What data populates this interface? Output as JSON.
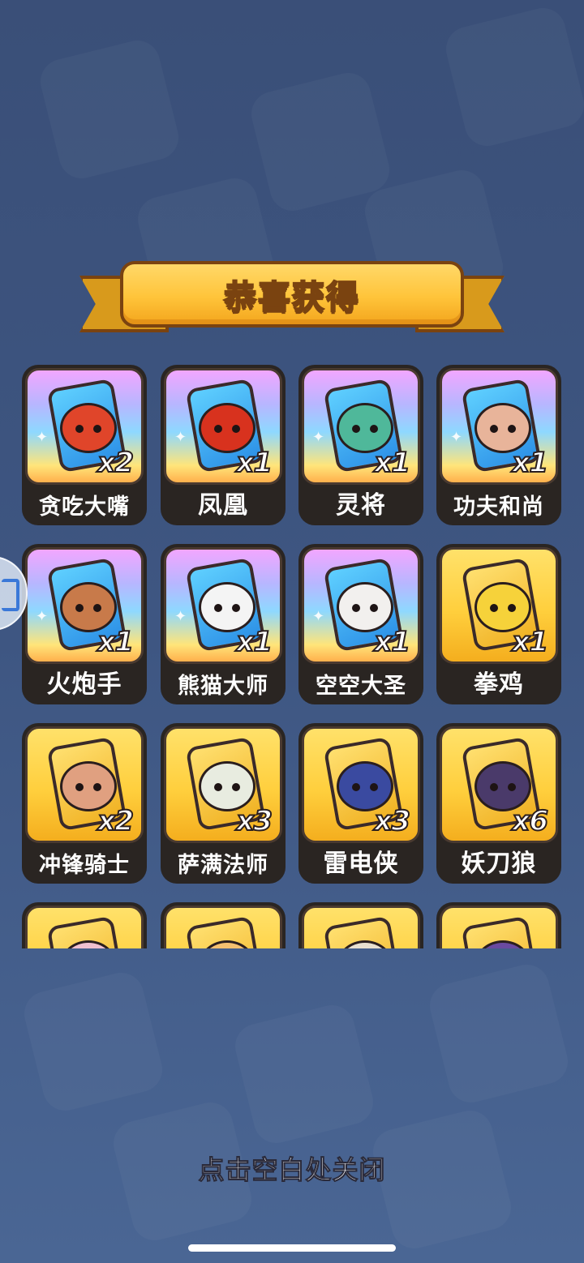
{
  "banner": {
    "title": "恭喜获得"
  },
  "rewards": [
    {
      "name": "贪吃大嘴",
      "count": "x2",
      "rarity": "rainbow",
      "face_color": "#e0452a"
    },
    {
      "name": "凤凰",
      "count": "x1",
      "rarity": "rainbow",
      "face_color": "#d8321e"
    },
    {
      "name": "灵将",
      "count": "x1",
      "rarity": "rainbow",
      "face_color": "#4fb89a"
    },
    {
      "name": "功夫和尚",
      "count": "x1",
      "rarity": "rainbow",
      "face_color": "#e8b49a"
    },
    {
      "name": "火炮手",
      "count": "x1",
      "rarity": "rainbow",
      "face_color": "#c87a4a"
    },
    {
      "name": "熊猫大师",
      "count": "x1",
      "rarity": "rainbow",
      "face_color": "#f4f4f4"
    },
    {
      "name": "空空大圣",
      "count": "x1",
      "rarity": "rainbow",
      "face_color": "#f2f0ee"
    },
    {
      "name": "拳鸡",
      "count": "x1",
      "rarity": "gold",
      "face_color": "#f6d23a"
    },
    {
      "name": "冲锋骑士",
      "count": "x2",
      "rarity": "gold",
      "face_color": "#e0a080"
    },
    {
      "name": "萨满法师",
      "count": "x3",
      "rarity": "gold",
      "face_color": "#e8ece0"
    },
    {
      "name": "雷电侠",
      "count": "x3",
      "rarity": "gold",
      "face_color": "#3a4aa0"
    },
    {
      "name": "妖刀狼",
      "count": "x6",
      "rarity": "gold",
      "face_color": "#4a3a6a"
    },
    {
      "name": "",
      "count": "",
      "rarity": "gold",
      "face_color": "#f0c0d0"
    },
    {
      "name": "",
      "count": "",
      "rarity": "gold",
      "face_color": "#f4c070"
    },
    {
      "name": "",
      "count": "",
      "rarity": "gold",
      "face_color": "#e8e0d0"
    },
    {
      "name": "",
      "count": "",
      "rarity": "gold",
      "face_color": "#6a4aa0"
    }
  ],
  "footer": {
    "close_hint": "点击空白处关闭"
  },
  "icons": {
    "side_button": "floating-assist-icon",
    "sparkle": "sparkle-icon"
  }
}
